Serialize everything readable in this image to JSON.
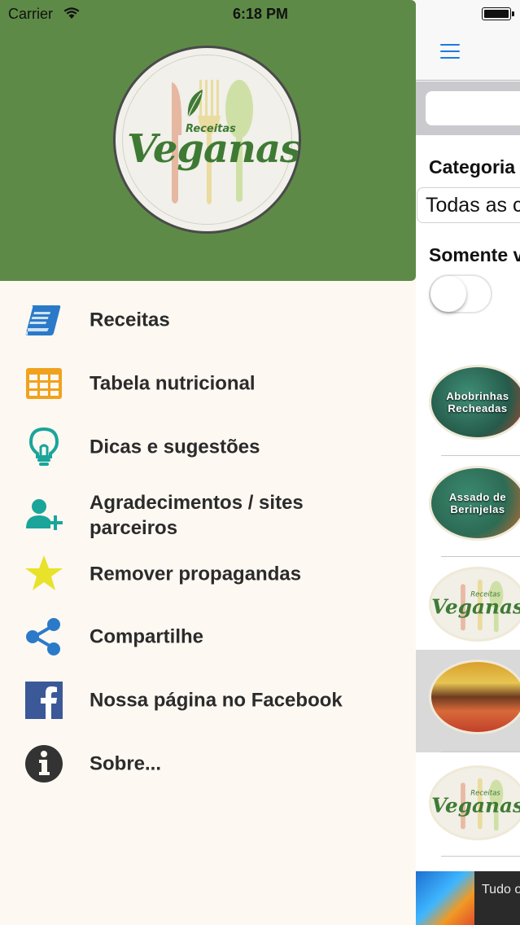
{
  "status_bar": {
    "carrier": "Carrier",
    "time": "6:18 PM"
  },
  "colors": {
    "drawer_header": "#5e8a47",
    "accent_blue": "#1f7ae0",
    "drawer_bg": "#fdf8f2",
    "icon_blue": "#2b7ac9",
    "icon_orange": "#f0a21e",
    "icon_teal": "#1aa59a",
    "icon_yellow": "#e8e22a",
    "facebook_blue": "#3b5998",
    "icon_dark": "#333333"
  },
  "logo": {
    "small_text": "Receitas",
    "big_text": "Veganas"
  },
  "drawer_menu": [
    {
      "label": "Receitas",
      "icon": "book-icon"
    },
    {
      "label": "Tabela nutricional",
      "icon": "table-grid-icon"
    },
    {
      "label": "Dicas e sugestões",
      "icon": "lightbulb-icon"
    },
    {
      "label": "Agradecimentos / sites parceiros",
      "icon": "add-user-icon"
    },
    {
      "label": "Remover propagandas",
      "icon": "star-icon"
    },
    {
      "label": "Compartilhe",
      "icon": "share-icon"
    },
    {
      "label": "Nossa página no Facebook",
      "icon": "facebook-icon"
    },
    {
      "label": "Sobre...",
      "icon": "info-icon"
    }
  ],
  "main": {
    "category_label": "Categoria",
    "category_value": "Todas as c",
    "only_label": "Somente v",
    "switch_on": false,
    "recipes": [
      {
        "title": "Abobrinhas Recheadas"
      },
      {
        "title": "Assado de Berinjelas"
      },
      {
        "title": ""
      },
      {
        "title": ""
      },
      {
        "title": ""
      }
    ],
    "ad_text": "Tudo o lugar!"
  }
}
